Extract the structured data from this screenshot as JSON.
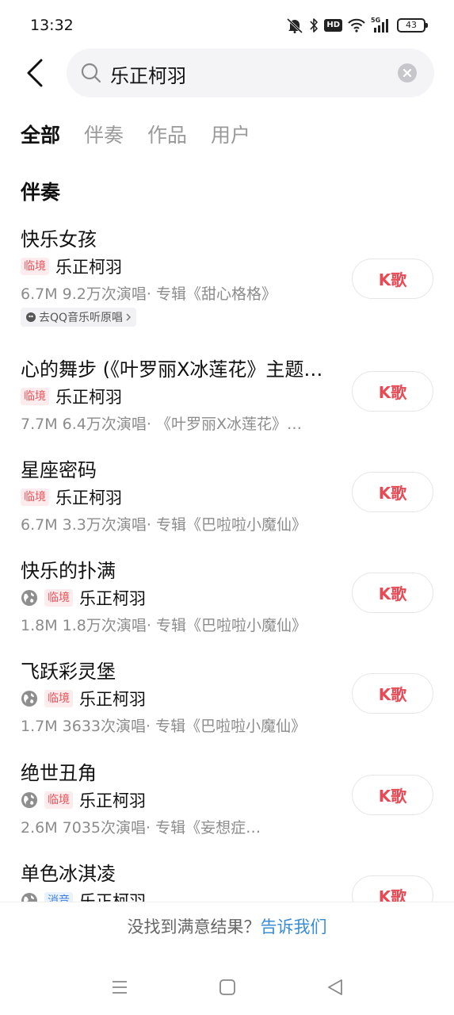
{
  "status_bar": {
    "time": "13:32",
    "hd_label": "HD",
    "network_label": "5G",
    "battery": "43"
  },
  "search": {
    "query": "乐正柯羽"
  },
  "tabs": [
    {
      "label": "全部",
      "active": true
    },
    {
      "label": "伴奏",
      "active": false
    },
    {
      "label": "作品",
      "active": false
    },
    {
      "label": "用户",
      "active": false
    }
  ],
  "section_title": "伴奏",
  "items": [
    {
      "title": "快乐女孩",
      "tag": "临境",
      "artist": "乐正柯羽",
      "meta": "6.7M 9.2万次演唱· 专辑《甜心格格》",
      "qq_link": "去QQ音乐听原唱",
      "button": "K歌"
    },
    {
      "title": "心的舞步 (《叶罗丽X冰莲花》主题…",
      "tag": "临境",
      "artist": "乐正柯羽",
      "meta": "7.7M 6.4万次演唱· 《叶罗丽X冰莲花》…",
      "button": "K歌"
    },
    {
      "title": "星座密码",
      "tag": "临境",
      "artist": "乐正柯羽",
      "meta": "6.7M 3.3万次演唱· 专辑《巴啦啦小魔仙》",
      "button": "K歌"
    },
    {
      "title": "快乐的扑满",
      "tag": "临境",
      "artist": "乐正柯羽",
      "meta": "1.8M 1.8万次演唱· 专辑《巴啦啦小魔仙》",
      "button": "K歌"
    },
    {
      "title": "飞跃彩灵堡",
      "tag": "临境",
      "artist": "乐正柯羽",
      "meta": "1.7M 3633次演唱· 专辑《巴啦啦小魔仙》",
      "button": "K歌"
    },
    {
      "title": "绝世丑角",
      "tag": "临境",
      "artist": "乐正柯羽",
      "meta": "2.6M 7035次演唱· 专辑《妄想症…",
      "button": "K歌"
    },
    {
      "title": "单色冰淇凌",
      "tag": "消音",
      "artist": "乐正柯羽",
      "button": "K歌"
    }
  ],
  "footer": {
    "prompt": "没找到满意结果？",
    "link": "告诉我们"
  },
  "colors": {
    "accent_red": "#e84a55",
    "link_blue": "#3a8cd6"
  }
}
